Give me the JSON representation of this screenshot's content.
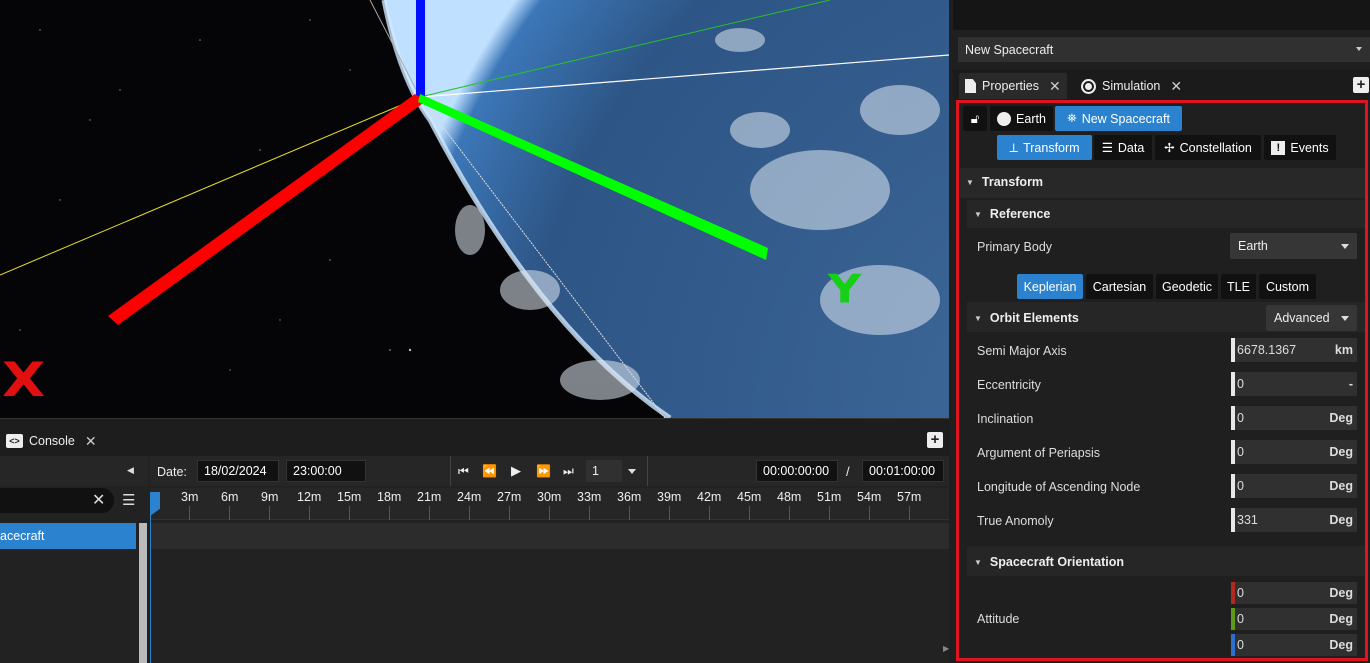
{
  "viewport": {
    "axis_x_label": "X",
    "axis_y_label": "Y"
  },
  "console": {
    "tab_label": "Console",
    "date_label": "Date:",
    "date_value": "18/02/2024",
    "time_value": "23:00:00",
    "speed_value": "1",
    "elapsed": "00:00:00:00",
    "separator": "/",
    "duration": "00:01:00:00",
    "list_item": "acecraft",
    "ticks": [
      "3m",
      "6m",
      "9m",
      "12m",
      "15m",
      "18m",
      "21m",
      "24m",
      "27m",
      "30m",
      "33m",
      "36m",
      "39m",
      "42m",
      "45m",
      "48m",
      "51m",
      "54m",
      "57m"
    ]
  },
  "top_selector": "New Spacecraft",
  "tabs": {
    "properties": "Properties",
    "simulation": "Simulation"
  },
  "breadcrumb": {
    "earth": "Earth",
    "spacecraft": "New Spacecraft"
  },
  "subtabs": {
    "transform": "Transform",
    "data": "Data",
    "constellation": "Constellation",
    "events": "Events"
  },
  "transform": {
    "header": "Transform",
    "reference_header": "Reference",
    "primary_body_label": "Primary Body",
    "primary_body_value": "Earth",
    "modes": [
      "Keplerian",
      "Cartesian",
      "Geodetic",
      "TLE",
      "Custom"
    ],
    "orbit_header": "Orbit Elements",
    "orbit_mode": "Advanced",
    "elements": [
      {
        "label": "Semi Major Axis",
        "value": "6678.1367",
        "unit": "km"
      },
      {
        "label": "Eccentricity",
        "value": "0",
        "unit": "-"
      },
      {
        "label": "Inclination",
        "value": "0",
        "unit": "Deg"
      },
      {
        "label": "Argument of Periapsis",
        "value": "0",
        "unit": "Deg"
      },
      {
        "label": "Longitude of Ascending Node",
        "value": "0",
        "unit": "Deg"
      },
      {
        "label": "True Anomoly",
        "value": "331",
        "unit": "Deg"
      }
    ],
    "orientation_header": "Spacecraft Orientation",
    "attitude_label": "Attitude",
    "attitude": [
      {
        "value": "0",
        "unit": "Deg",
        "color": "#b02a1e"
      },
      {
        "value": "0",
        "unit": "Deg",
        "color": "#5e9a17"
      },
      {
        "value": "0",
        "unit": "Deg",
        "color": "#2b6fd1"
      }
    ]
  }
}
